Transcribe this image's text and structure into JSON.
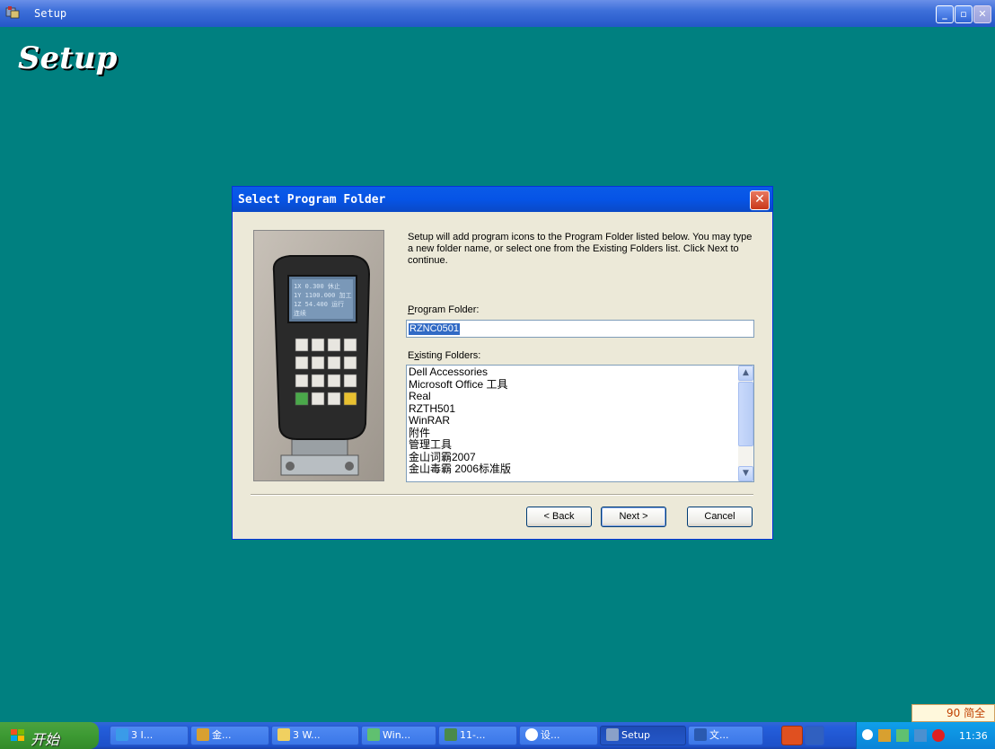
{
  "window": {
    "title": "Setup",
    "big_title": "Setup"
  },
  "dialog": {
    "title": "Select Program Folder",
    "description": "Setup will add program icons to the Program Folder listed below. You may type a new folder name, or select one from the Existing Folders list. Click Next to continue.",
    "program_folder_label_hotkey": "P",
    "program_folder_label_rest": "rogram Folder:",
    "program_folder_value": "RZNC0501",
    "existing_label_pre": "E",
    "existing_label_hotkey": "x",
    "existing_label_rest": "isting Folders:",
    "existing_folders": [
      "Dell Accessories",
      "Microsoft Office 工具",
      "Real",
      "RZTH501",
      "WinRAR",
      "附件",
      "管理工具",
      "金山词霸2007",
      "金山毒霸 2006标准版"
    ],
    "buttons": {
      "back": "< Back",
      "next": "Next >",
      "cancel": "Cancel"
    }
  },
  "device_screen_lines": [
    "1X  0.300 休止",
    "1Y 1100.000 加工",
    "1Z  54.400 运行",
    "连续"
  ],
  "taskbar": {
    "start_label": "开始",
    "tasks": [
      "3 I...",
      "金...",
      "3 W...",
      "Win...",
      "11-...",
      "设...",
      "Setup",
      "文..."
    ],
    "clock": "11:36",
    "ime": "90 简全"
  },
  "colors": {
    "desktop": "#008080",
    "title_blue": "#0a5be8",
    "dialog_face": "#ece9d8"
  }
}
